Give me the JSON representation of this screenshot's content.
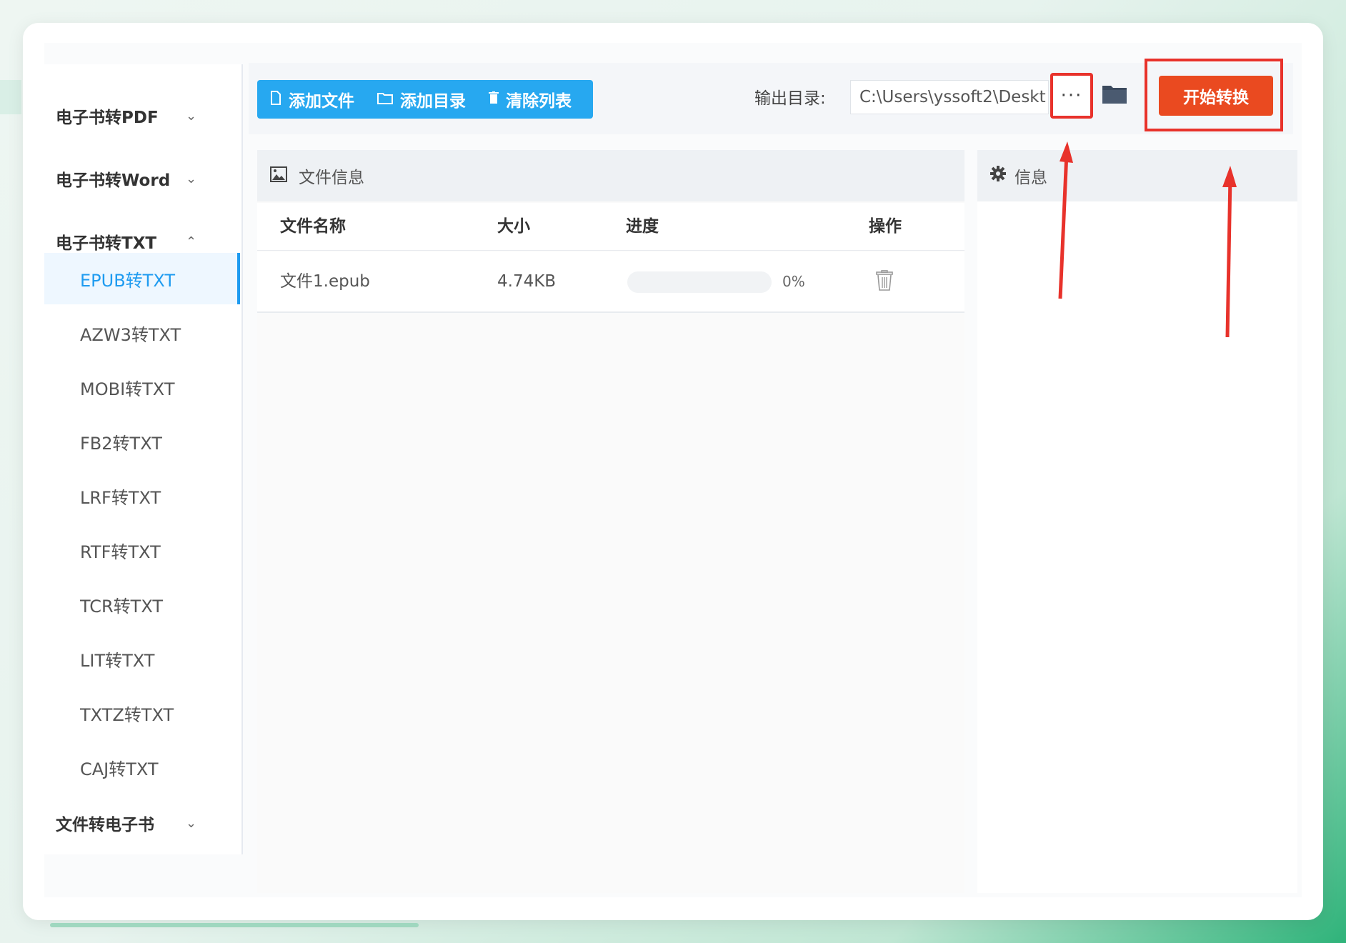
{
  "sidebar": {
    "groups": [
      {
        "label": "电子书转PDF",
        "chevron": "⌄"
      },
      {
        "label": "电子书转Word",
        "chevron": "⌄"
      },
      {
        "label": "电子书转TXT",
        "chevron": "⌃"
      },
      {
        "label": "文件转电子书",
        "chevron": "⌄"
      }
    ],
    "items": [
      {
        "label": "EPUB转TXT",
        "active": true
      },
      {
        "label": "AZW3转TXT"
      },
      {
        "label": "MOBI转TXT"
      },
      {
        "label": "FB2转TXT"
      },
      {
        "label": "LRF转TXT"
      },
      {
        "label": "RTF转TXT"
      },
      {
        "label": "TCR转TXT"
      },
      {
        "label": "LIT转TXT"
      },
      {
        "label": "TXTZ转TXT"
      },
      {
        "label": "CAJ转TXT"
      }
    ]
  },
  "toolbar": {
    "add_file": "添加文件",
    "add_dir": "添加目录",
    "clear_list": "清除列表",
    "output_label": "输出目录:",
    "output_path": "C:\\Users\\yssoft2\\Deskt",
    "more": "···",
    "start": "开始转换"
  },
  "file_panel": {
    "title": "文件信息",
    "columns": [
      "文件名称",
      "大小",
      "进度",
      "操作"
    ],
    "rows": [
      {
        "name": "文件1.epub",
        "size": "4.74KB",
        "progress": 0,
        "progress_text": "0%"
      }
    ]
  },
  "info_panel": {
    "title": "信息"
  },
  "colors": {
    "accent": "#27a8f0",
    "start": "#ea4a20",
    "highlight": "#e8322b"
  }
}
